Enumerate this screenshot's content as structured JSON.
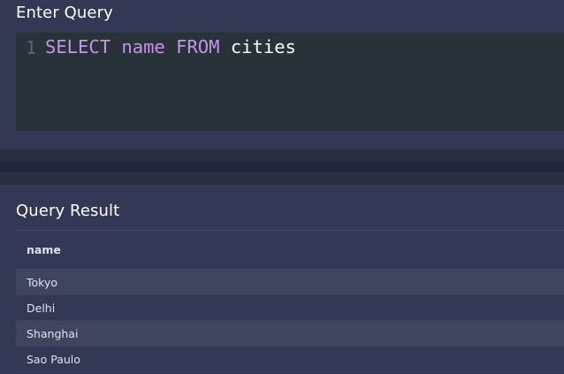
{
  "query_panel": {
    "title": "Enter Query",
    "line_number": "1",
    "tokens": {
      "kw_select": "SELECT",
      "column": "name",
      "kw_from": "FROM",
      "table": "cities"
    }
  },
  "result_panel": {
    "title": "Query Result",
    "columns": [
      "name"
    ],
    "rows": [
      "Tokyo",
      "Delhi",
      "Shanghai",
      "Sao Paulo"
    ]
  },
  "colors": {
    "background": "#2f344e",
    "panel": "#333955",
    "editor": "#283339",
    "keyword": "#c792ea",
    "identifier": "#eeffff",
    "row_alt": "#3f455f"
  }
}
